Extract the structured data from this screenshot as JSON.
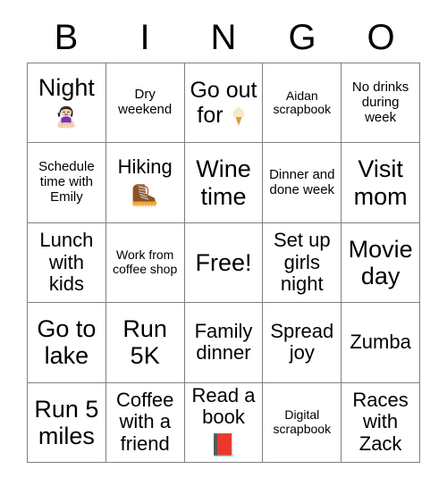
{
  "header": {
    "letters": [
      "B",
      "I",
      "N",
      "G",
      "O"
    ]
  },
  "colors": {
    "grid_line": "#808080",
    "background": "#ffffff",
    "text": "#000000",
    "book_red": "#e8392c",
    "shirt_purple": "#7b2fbe",
    "boot_brown": "#8d5524",
    "boot_sole_yellow": "#f2a73b",
    "ice_cream_cream": "#f7e8c8",
    "ice_cream_cone": "#e8a33d",
    "skin": "#f3d2b3",
    "hair": "#2b2b2b"
  },
  "grid": {
    "rows": [
      [
        {
          "text": "Night",
          "emoji": "person-in-lotus-position-emoji",
          "emoji_position": "below",
          "size": "xl"
        },
        {
          "text": "Dry weekend",
          "emoji": null,
          "emoji_position": null,
          "size": "sm"
        },
        {
          "text": "Go out for",
          "emoji": "ice-cream-cone-emoji",
          "emoji_position": "inline",
          "size": "lg"
        },
        {
          "text": "Aidan scrapbook",
          "emoji": null,
          "emoji_position": null,
          "size": "xs"
        },
        {
          "text": "No drinks during week",
          "emoji": null,
          "emoji_position": null,
          "size": "sm"
        }
      ],
      [
        {
          "text": "Schedule time with Emily",
          "emoji": null,
          "emoji_position": null,
          "size": "sm"
        },
        {
          "text": "Hiking",
          "emoji": "hiking-boot-emoji",
          "emoji_position": "below",
          "size": "md"
        },
        {
          "text": "Wine time",
          "emoji": null,
          "emoji_position": null,
          "size": "xl"
        },
        {
          "text": "Dinner and done week",
          "emoji": null,
          "emoji_position": null,
          "size": "sm"
        },
        {
          "text": "Visit mom",
          "emoji": null,
          "emoji_position": null,
          "size": "xl"
        }
      ],
      [
        {
          "text": "Lunch with kids",
          "emoji": null,
          "emoji_position": null,
          "size": "md"
        },
        {
          "text": "Work from coffee shop",
          "emoji": null,
          "emoji_position": null,
          "size": "xs"
        },
        {
          "text": "Free!",
          "emoji": null,
          "emoji_position": null,
          "size": "xl"
        },
        {
          "text": "Set up girls night",
          "emoji": null,
          "emoji_position": null,
          "size": "md"
        },
        {
          "text": "Movie day",
          "emoji": null,
          "emoji_position": null,
          "size": "xl"
        }
      ],
      [
        {
          "text": "Go to lake",
          "emoji": null,
          "emoji_position": null,
          "size": "xl"
        },
        {
          "text": "Run 5K",
          "emoji": null,
          "emoji_position": null,
          "size": "xl"
        },
        {
          "text": "Family dinner",
          "emoji": null,
          "emoji_position": null,
          "size": "md"
        },
        {
          "text": "Spread joy",
          "emoji": null,
          "emoji_position": null,
          "size": "md"
        },
        {
          "text": "Zumba",
          "emoji": null,
          "emoji_position": null,
          "size": "md"
        }
      ],
      [
        {
          "text": "Run 5 miles",
          "emoji": null,
          "emoji_position": null,
          "size": "xl"
        },
        {
          "text": "Coffee with a friend",
          "emoji": null,
          "emoji_position": null,
          "size": "md"
        },
        {
          "text": "Read a book",
          "emoji": "closed-book-emoji",
          "emoji_position": "below",
          "size": "md"
        },
        {
          "text": "Digital scrapbook",
          "emoji": null,
          "emoji_position": null,
          "size": "xs"
        },
        {
          "text": "Races with Zack",
          "emoji": null,
          "emoji_position": null,
          "size": "md"
        }
      ]
    ]
  }
}
